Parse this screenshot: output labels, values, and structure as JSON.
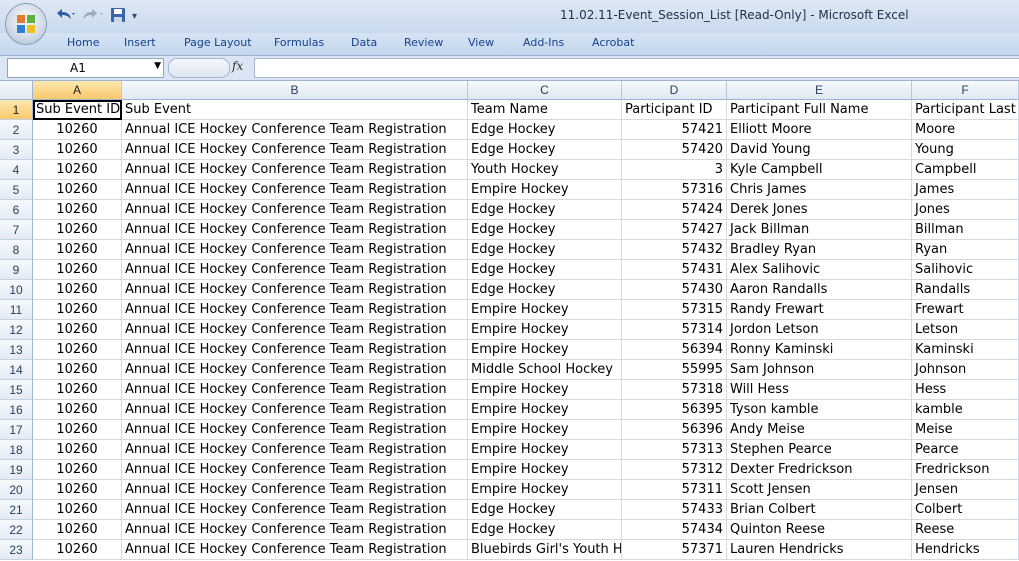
{
  "window": {
    "title": "11.02.11-Event_Session_List  [Read-Only] - Microsoft Excel"
  },
  "qat": {
    "undo_icon": "undo-icon",
    "redo_icon": "redo-icon",
    "save_icon": "save-icon",
    "customize": "▾"
  },
  "ribbon": {
    "tabs": [
      "Home",
      "Insert",
      "Page Layout",
      "Formulas",
      "Data",
      "Review",
      "View",
      "Add-Ins",
      "Acrobat"
    ]
  },
  "formula_bar": {
    "name_box": "A1",
    "fx_label": "fx",
    "content": ""
  },
  "sheet": {
    "columns": [
      "A",
      "B",
      "C",
      "D",
      "E",
      "F"
    ],
    "row_numbers": [
      "1",
      "2",
      "3",
      "4",
      "5",
      "6",
      "7",
      "8",
      "9",
      "10",
      "11",
      "12",
      "13",
      "14",
      "15",
      "16",
      "17",
      "18",
      "19",
      "20",
      "21",
      "22",
      "23"
    ],
    "header": [
      "Sub Event ID",
      "Sub Event",
      "Team Name",
      "Participant ID",
      "Participant Full Name",
      "Participant Last Name"
    ],
    "rows": [
      [
        "10260",
        "Annual ICE Hockey Conference Team Registration",
        "Edge Hockey",
        "57421",
        "Elliott Moore",
        "Moore"
      ],
      [
        "10260",
        "Annual ICE Hockey Conference Team Registration",
        "Edge Hockey",
        "57420",
        "David  Young",
        "Young"
      ],
      [
        "10260",
        "Annual ICE Hockey Conference Team Registration",
        "Youth Hockey",
        "3",
        "Kyle  Campbell",
        "Campbell"
      ],
      [
        "10260",
        "Annual ICE Hockey Conference Team Registration",
        "Empire Hockey",
        "57316",
        "Chris James",
        "James"
      ],
      [
        "10260",
        "Annual ICE Hockey Conference Team Registration",
        "Edge Hockey",
        "57424",
        "Derek Jones",
        "Jones"
      ],
      [
        "10260",
        "Annual ICE Hockey Conference Team Registration",
        "Edge Hockey",
        "57427",
        "Jack Billman",
        "Billman"
      ],
      [
        "10260",
        "Annual ICE Hockey Conference Team Registration",
        "Edge Hockey",
        "57432",
        "Bradley Ryan",
        "Ryan"
      ],
      [
        "10260",
        "Annual ICE Hockey Conference Team Registration",
        "Edge Hockey",
        "57431",
        "Alex Salihovic",
        "Salihovic"
      ],
      [
        "10260",
        "Annual ICE Hockey Conference Team Registration",
        "Edge Hockey",
        "57430",
        "Aaron Randalls",
        "Randalls"
      ],
      [
        "10260",
        "Annual ICE Hockey Conference Team Registration",
        "Empire Hockey",
        "57315",
        "Randy Frewart",
        "Frewart"
      ],
      [
        "10260",
        "Annual ICE Hockey Conference Team Registration",
        "Empire Hockey",
        "57314",
        "Jordon Letson",
        "Letson"
      ],
      [
        "10260",
        "Annual ICE Hockey Conference Team Registration",
        "Empire Hockey",
        "56394",
        "Ronny Kaminski",
        "Kaminski"
      ],
      [
        "10260",
        "Annual ICE Hockey Conference Team Registration",
        "Middle School Hockey",
        "55995",
        "Sam  Johnson",
        "Johnson"
      ],
      [
        "10260",
        "Annual ICE Hockey Conference Team Registration",
        "Empire Hockey",
        "57318",
        "Will Hess",
        "Hess"
      ],
      [
        "10260",
        "Annual ICE Hockey Conference Team Registration",
        "Empire Hockey",
        "56395",
        "Tyson kamble",
        "kamble"
      ],
      [
        "10260",
        "Annual ICE Hockey Conference Team Registration",
        "Empire Hockey",
        "56396",
        "Andy Meise",
        "Meise"
      ],
      [
        "10260",
        "Annual ICE Hockey Conference Team Registration",
        "Empire Hockey",
        "57313",
        "Stephen Pearce",
        "Pearce"
      ],
      [
        "10260",
        "Annual ICE Hockey Conference Team Registration",
        "Empire Hockey",
        "57312",
        "Dexter Fredrickson",
        "Fredrickson"
      ],
      [
        "10260",
        "Annual ICE Hockey Conference Team Registration",
        "Empire Hockey",
        "57311",
        "Scott  Jensen",
        "Jensen"
      ],
      [
        "10260",
        "Annual ICE Hockey Conference Team Registration",
        "Edge Hockey",
        "57433",
        "Brian  Colbert",
        " Colbert"
      ],
      [
        "10260",
        "Annual ICE Hockey Conference Team Registration",
        "Edge Hockey",
        "57434",
        "Quinton Reese",
        "Reese"
      ],
      [
        "10260",
        "Annual ICE Hockey Conference Team Registration",
        "Bluebirds Girl's Youth Hockey",
        "57371",
        "Lauren Hendricks",
        "Hendricks"
      ]
    ]
  }
}
